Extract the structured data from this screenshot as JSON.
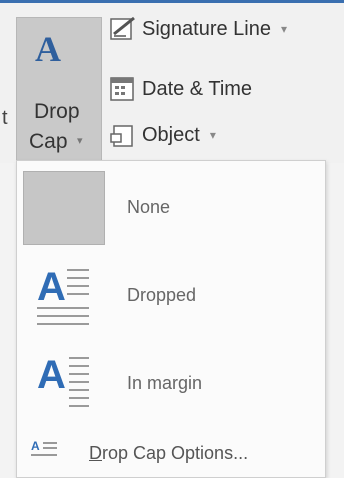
{
  "ribbon": {
    "cut_text": "t",
    "drop_cap": {
      "label_line1": "Drop",
      "label_line2": "Cap",
      "glyph": "A",
      "arrow": "▾"
    },
    "commands": [
      {
        "label": "Signature Line",
        "arrow": "▾",
        "icon": "signature-pen-icon"
      },
      {
        "label": "Date & Time",
        "arrow": "",
        "icon": "calendar-icon"
      },
      {
        "label": "Object",
        "arrow": "▾",
        "icon": "object-icon"
      }
    ]
  },
  "menu": {
    "items": [
      {
        "label": "None",
        "icon": "no-dropcap-icon"
      },
      {
        "label": "Dropped",
        "icon": "dropped-dropcap-icon",
        "glyph": "A"
      },
      {
        "label": "In margin",
        "icon": "in-margin-dropcap-icon",
        "glyph": "A"
      }
    ],
    "options": {
      "label_first": "D",
      "label_rest": "rop Cap Options...",
      "icon_text": "A"
    }
  },
  "colors": {
    "accent": "#2f6cb5",
    "selected_bg": "#c9c9c9"
  }
}
